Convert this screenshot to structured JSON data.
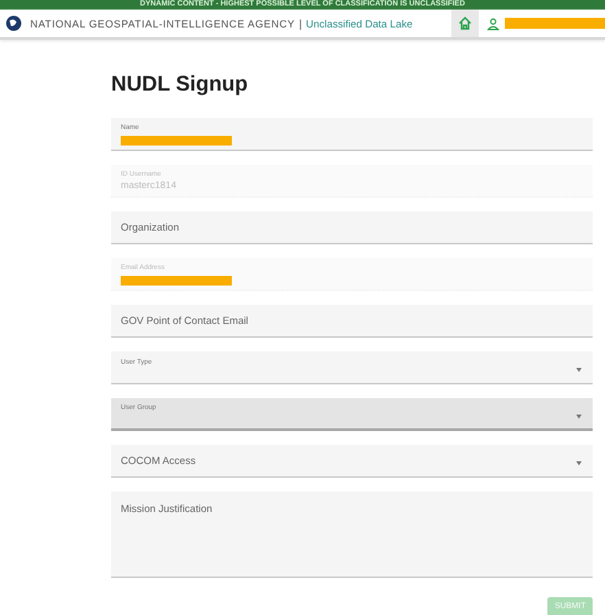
{
  "banner": {
    "text": "DYNAMIC CONTENT - HIGHEST POSSIBLE LEVEL OF CLASSIFICATION IS UNCLASSIFIED"
  },
  "header": {
    "agency": "NATIONAL GEOSPATIAL-INTELLIGENCE AGENCY",
    "separator": "|",
    "app": "Unclassified Data Lake",
    "user_redacted": true
  },
  "title": "NUDL Signup",
  "fields": [
    {
      "kind": "text",
      "label": "Name",
      "floated": true,
      "redacted": true,
      "disabled": false,
      "focused": false
    },
    {
      "kind": "text",
      "label": "ID Username",
      "floated": true,
      "value": "masterc1814",
      "disabled": true,
      "focused": false
    },
    {
      "kind": "text",
      "label": "Organization",
      "floated": false,
      "disabled": false,
      "focused": false
    },
    {
      "kind": "text",
      "label": "Email Address",
      "floated": true,
      "redacted": true,
      "disabled": true,
      "focused": false
    },
    {
      "kind": "text",
      "label": "GOV Point of Contact Email",
      "floated": false,
      "disabled": false,
      "focused": false
    },
    {
      "kind": "select",
      "label": "User Type",
      "floated": true,
      "disabled": false,
      "focused": false
    },
    {
      "kind": "select",
      "label": "User Group",
      "floated": true,
      "disabled": false,
      "focused": true
    },
    {
      "kind": "select",
      "label": "COCOM Access",
      "floated": false,
      "disabled": false,
      "focused": false
    },
    {
      "kind": "textarea",
      "label": "Mission Justification",
      "floated": false,
      "disabled": false,
      "focused": false
    }
  ],
  "submit": {
    "label": "SUBMIT",
    "disabled": true
  }
}
